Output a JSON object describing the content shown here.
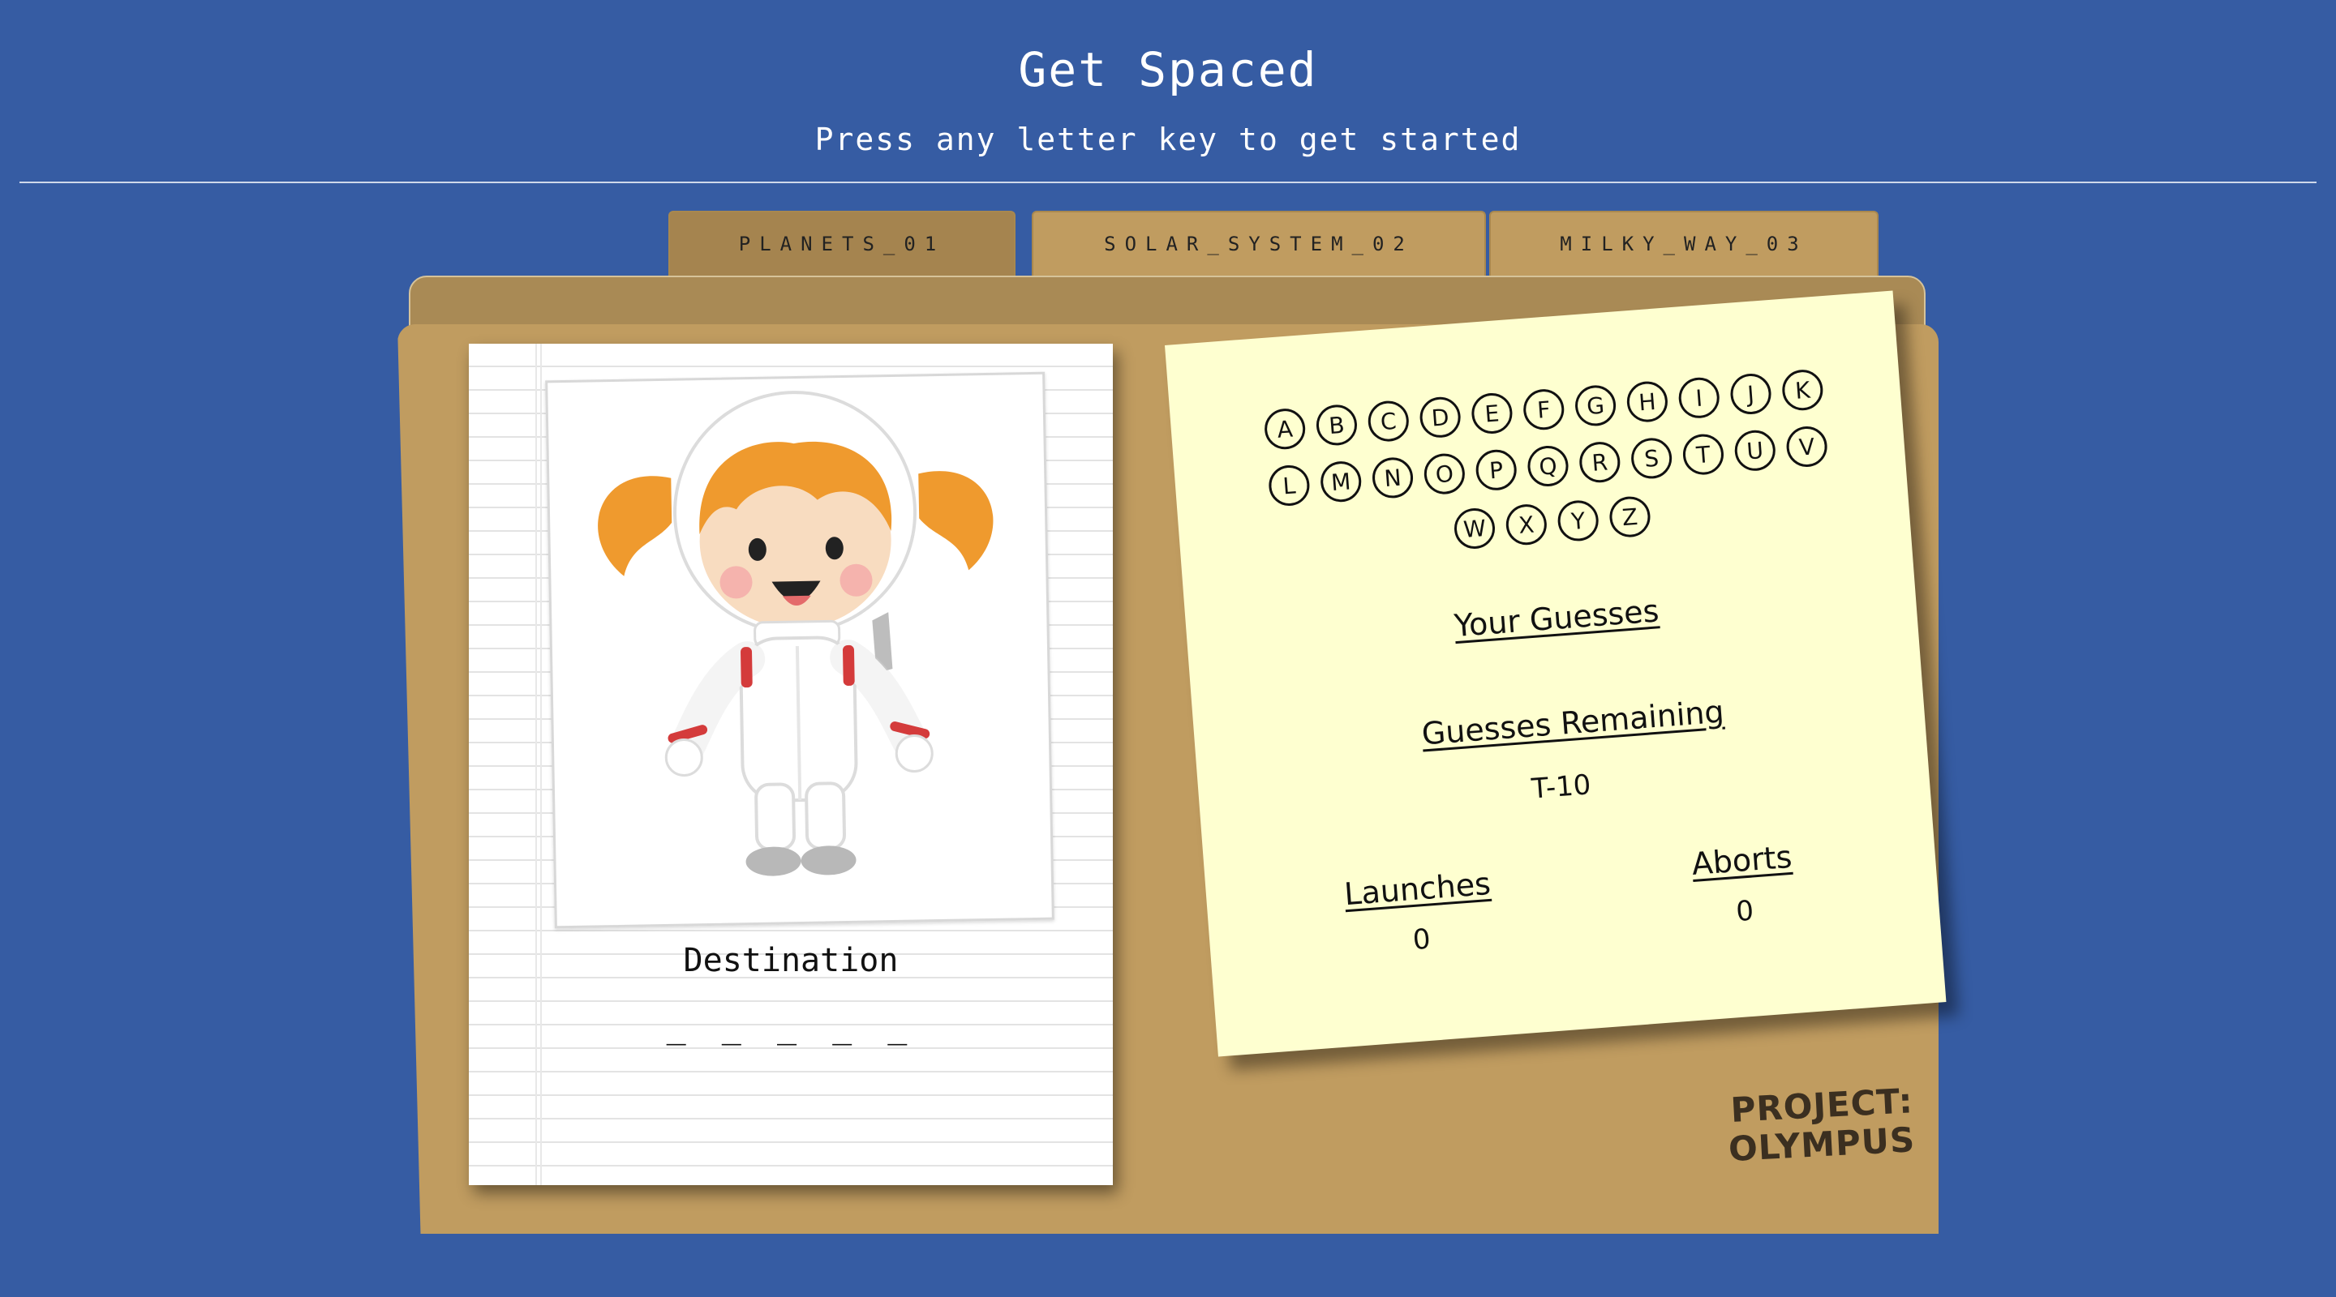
{
  "header": {
    "title": "Get Spaced",
    "subtitle": "Press any letter key to get started"
  },
  "tabs": [
    {
      "label": "PLANETS_01",
      "active": true
    },
    {
      "label": "SOLAR_SYSTEM_02",
      "active": false
    },
    {
      "label": "MILKY_WAY_03",
      "active": false
    }
  ],
  "card": {
    "image_alt": "astronaut girl icon",
    "destination_label": "Destination",
    "word_blanks": "_ _ _ _ _"
  },
  "letters": [
    "A",
    "B",
    "C",
    "D",
    "E",
    "F",
    "G",
    "H",
    "I",
    "J",
    "K",
    "L",
    "M",
    "N",
    "O",
    "P",
    "Q",
    "R",
    "S",
    "T",
    "U",
    "V",
    "W",
    "X",
    "Y",
    "Z"
  ],
  "stats": {
    "your_guesses_label": "Your Guesses",
    "guesses_remaining_label": "Guesses Remaining",
    "guesses_remaining_value": "T-10",
    "launches_label": "Launches",
    "launches_value": "0",
    "aborts_label": "Aborts",
    "aborts_value": "0"
  },
  "stamp": {
    "line1": "PROJECT:",
    "line2": "OLYMPUS"
  },
  "colors": {
    "background": "#365ca3",
    "folder": "#c09c60",
    "sticky_note": "#feffd0",
    "tab_active": "#a5844f"
  }
}
